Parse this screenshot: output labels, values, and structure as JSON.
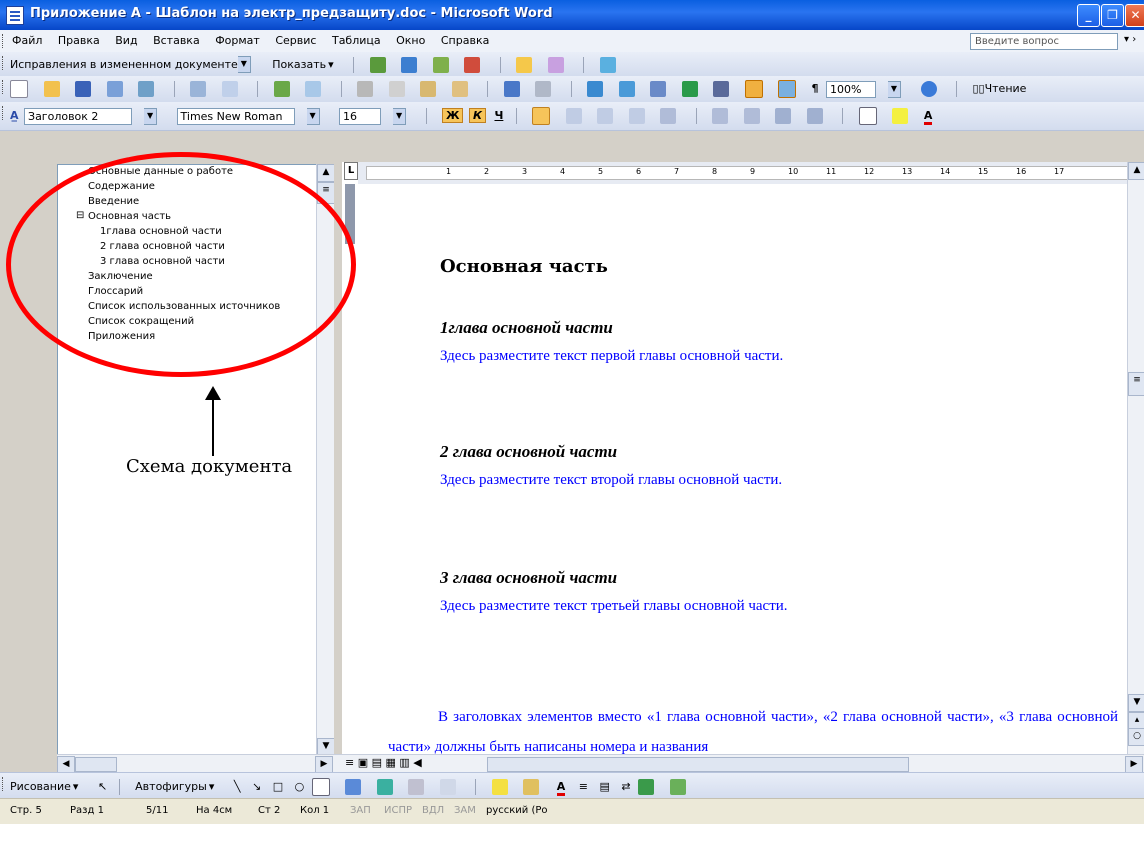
{
  "window": {
    "title": "Приложение А - Шаблон на электр_предзащиту.doc - Microsoft Word"
  },
  "menu": {
    "items": [
      "Файл",
      "Правка",
      "Вид",
      "Вставка",
      "Формат",
      "Сервис",
      "Таблица",
      "Окно",
      "Справка"
    ],
    "help_placeholder": "Введите вопрос"
  },
  "review_toolbar": {
    "mode": "Исправления в измененном документе",
    "show": "Показать"
  },
  "standard_toolbar": {
    "zoom": "100%",
    "reading": "Чтение"
  },
  "format_toolbar": {
    "style": "Заголовок 2",
    "font": "Times New Roman",
    "size": "16",
    "bold": "Ж",
    "italic": "К",
    "underline": "Ч"
  },
  "doc_map": {
    "items": [
      {
        "label": "Основные данные о работе",
        "level": 1
      },
      {
        "label": "Содержание",
        "level": 1
      },
      {
        "label": "Введение",
        "level": 1
      },
      {
        "label": "Основная часть",
        "level": 1
      },
      {
        "label": "1глава основной части",
        "level": 2
      },
      {
        "label": "2 глава основной части",
        "level": 2
      },
      {
        "label": "3 глава основной части",
        "level": 2
      },
      {
        "label": "Заключение",
        "level": 1
      },
      {
        "label": "Глоссарий",
        "level": 1
      },
      {
        "label": "Список использованных источников",
        "level": 1
      },
      {
        "label": "Список сокращений",
        "level": 1
      },
      {
        "label": "Приложения",
        "level": 1
      }
    ]
  },
  "document": {
    "heading": "Основная часть",
    "sections": [
      {
        "title": "1глава основной части",
        "text": "Здесь разместите текст первой главы основной части."
      },
      {
        "title": "2 глава основной части",
        "text": "Здесь разместите текст второй главы основной части."
      },
      {
        "title": "3 глава основной части",
        "text": "Здесь разместите текст третьей главы основной части."
      }
    ],
    "paragraph": "В заголовках элементов вместо «1 глава основной части», «2 глава основной части», «3 глава основной части» должны быть написаны номера и названия"
  },
  "ruler": {
    "marks": [
      "1",
      "2",
      "3",
      "4",
      "5",
      "6",
      "7",
      "8",
      "9",
      "10",
      "11",
      "12",
      "13",
      "14",
      "15",
      "16",
      "17"
    ]
  },
  "draw_toolbar": {
    "drawing": "Рисование",
    "autoshapes": "Автофигуры"
  },
  "status": {
    "page": "Стр. 5",
    "section": "Разд 1",
    "pages": "5/11",
    "at": "На 4см",
    "line": "Ст 2",
    "col": "Кол 1",
    "rec": "ЗАП",
    "trk": "ИСПР",
    "ext": "ВДЛ",
    "ovr": "ЗАМ",
    "lang": "русский (Ро"
  },
  "annotation": {
    "caption": "Схема документа",
    "ellipse_color": "#ff0000"
  }
}
